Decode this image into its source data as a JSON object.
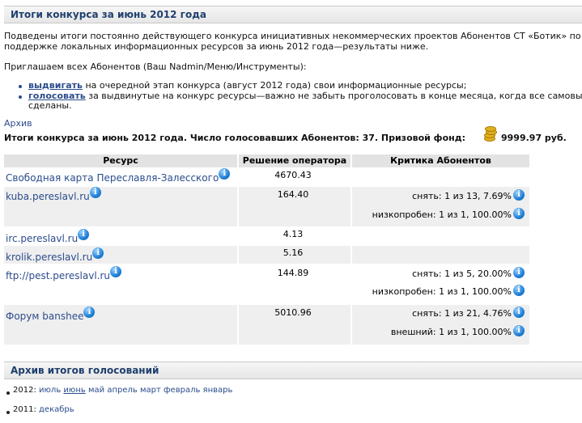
{
  "section1": {
    "title": "Итоги конкурса за июнь 2012 года",
    "para_line1": "Подведены итоги постоянно действующего конкурса инициативных некоммерческих проектов Абонентов СТ «Ботик» по",
    "para_line2": "поддержке локальных информационных ресурсов за июнь 2012 года—результаты ниже.",
    "invite": "Приглашаем всех Абонентов (Ваш Nadmin/Меню/Инструменты):",
    "bullets": [
      {
        "link": "выдвигать",
        "text": " на очередной этап конкурса (август 2012 года) свои информационные ресурсы;"
      },
      {
        "link": "голосовать",
        "text": " за выдвинутые на конкурс ресурсы—важно не забыть проголосовать в конце месяца, когда все самовыдвиж",
        "line2": "сделаны."
      }
    ],
    "archive_link": "Архив",
    "summary": "Итоги конкурса за июнь 2012 года. Число голосовавших Абонентов: 37. Призовой фонд:",
    "fund": "9999.97 руб."
  },
  "table": {
    "headers": [
      "Ресурс",
      "Решение оператора",
      "Критика Абонентов"
    ],
    "rows": [
      {
        "resource": "Свободная карта Переславля-Залесского",
        "decision": "4670.43",
        "critique": []
      },
      {
        "resource": "kuba.pereslavl.ru",
        "decision": "164.40",
        "critique": [
          "снять: 1 из 13, 7.69%",
          "низкопробен: 1 из 1, 100.00%"
        ]
      },
      {
        "resource": "irc.pereslavl.ru",
        "decision": "4.13",
        "critique": []
      },
      {
        "resource": "krolik.pereslavl.ru",
        "decision": "5.16",
        "critique": []
      },
      {
        "resource": "ftp://pest.pereslavl.ru",
        "decision": "144.89",
        "critique": [
          "снять: 1 из 5, 20.00%",
          "низкопробен: 1 из 1, 100.00%"
        ]
      },
      {
        "resource": "Форум banshee",
        "decision": "5010.96",
        "critique": [
          "снять: 1 из 21, 4.76%",
          "внешний: 1 из 1, 100.00%"
        ]
      }
    ]
  },
  "section2": {
    "title": "Архив итогов голосований",
    "years": [
      {
        "year": "2012:",
        "months": [
          "июль",
          "июнь",
          "май",
          "апрель",
          "март",
          "февраль",
          "январь"
        ],
        "current": "июнь"
      },
      {
        "year": "2011:",
        "months": [
          "декабрь"
        ]
      }
    ]
  },
  "colors": {
    "link": "#2b4c8c",
    "header_text": "#1f3f6e",
    "info_icon": "#1f7fd6"
  },
  "icons": [
    "info-icon",
    "coins-icon"
  ]
}
